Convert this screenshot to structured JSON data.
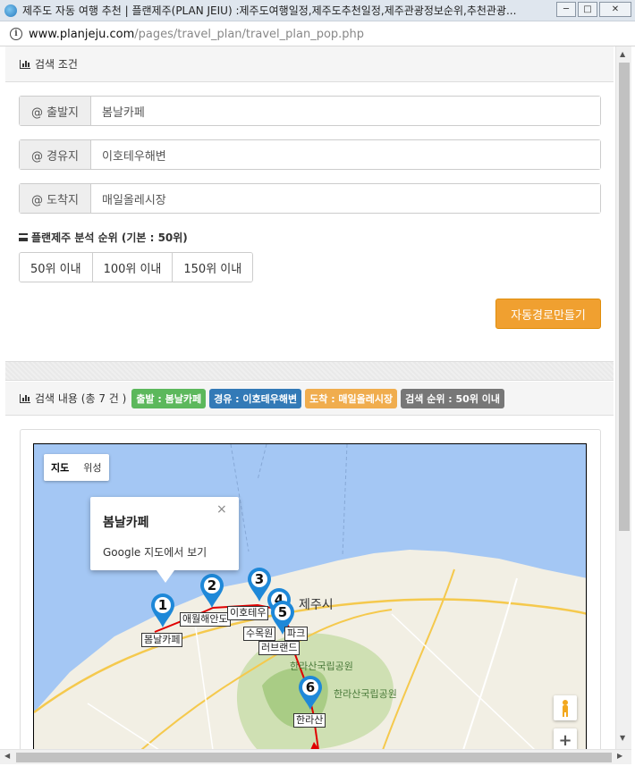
{
  "window": {
    "title": "제주도 자동 여행 추천 | 플랜제주(PLAN JEIU) :제주도여행일정,제주도추천일정,제주관광정보순위,추천관광...",
    "url_domain": "www.planjeju.com",
    "url_path": "/pages/travel_plan/travel_plan_pop.php",
    "controls": {
      "minimize": "─",
      "maximize": "□",
      "close": "✕"
    }
  },
  "search": {
    "heading": "검색 조건",
    "start": {
      "label": "@ 출발지",
      "value": "봄날카페"
    },
    "via": {
      "label": "@ 경유지",
      "value": "이호테우해변"
    },
    "end": {
      "label": "@ 도착지",
      "value": "매일올레시장"
    },
    "rank_label": "플랜제주 분석 순위 (기본 : 50위)",
    "rank_options": [
      "50위 이내",
      "100위 이내",
      "150위 이내"
    ],
    "auto_button": "자동경로만들기"
  },
  "results": {
    "heading": "검색 내용 (총 7 건 )",
    "badges": [
      {
        "text": "출발 : 봄날카페",
        "color": "#5cb85c"
      },
      {
        "text": "경유 : 이호테우해변",
        "color": "#337ab7"
      },
      {
        "text": "도착 : 매일올레시장",
        "color": "#f0ad4e"
      },
      {
        "text": "검색 순위 : 50위 이내",
        "color": "#777777"
      }
    ]
  },
  "map": {
    "type_options": [
      "지도",
      "위성"
    ],
    "infowindow": {
      "title": "봄날카페",
      "link": "Google 지도에서 보기",
      "close": "×"
    },
    "city_label": "제주시",
    "park_labels": [
      "한라산국립공원",
      "한라산국립공원"
    ],
    "markers": [
      {
        "num": "1",
        "label": "봄날카페"
      },
      {
        "num": "2",
        "label": "애월해안도"
      },
      {
        "num": "3",
        "label": "이호테우"
      },
      {
        "num": "4",
        "label": ""
      },
      {
        "num": "5",
        "label": "수목원"
      },
      {
        "num": "",
        "label": "파크"
      },
      {
        "num": "",
        "label": "러브랜드"
      },
      {
        "num": "6",
        "label": "한라산"
      }
    ],
    "zoom_in": "+",
    "marker_color": "#1e88d8",
    "route_color": "#e00000"
  }
}
